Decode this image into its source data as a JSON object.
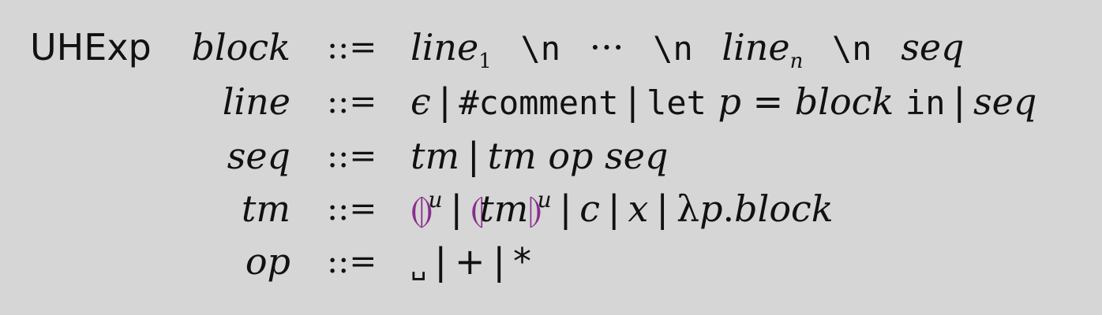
{
  "sort_name": "UHExp",
  "define": "::=",
  "bar": "|",
  "rules": {
    "block": {
      "lhs": "block",
      "line1": "line",
      "sub1": "1",
      "newline": "\\n",
      "dots": "···",
      "linen": "line",
      "subn": "n",
      "seq": "seq"
    },
    "line": {
      "lhs": "line",
      "epsilon": "ϵ",
      "comment": "#comment",
      "let_kw": "let",
      "p": "p",
      "eq": "=",
      "block": "block",
      "in_kw": "in",
      "seq": "seq"
    },
    "seq": {
      "lhs": "seq",
      "tm": "tm",
      "tm2": "tm",
      "op": "op",
      "seq": "seq"
    },
    "tm": {
      "lhs": "tm",
      "empty_hole": "⦇⦈",
      "hole_open": "⦇",
      "hole_close": "⦈",
      "hole_tm": "tm",
      "u": "u",
      "c": "c",
      "x": "x",
      "lambda": "λ",
      "p": "p",
      "dot": ".",
      "block": "block"
    },
    "op": {
      "lhs": "op",
      "space": "␣",
      "plus": "+",
      "star": "*"
    }
  }
}
